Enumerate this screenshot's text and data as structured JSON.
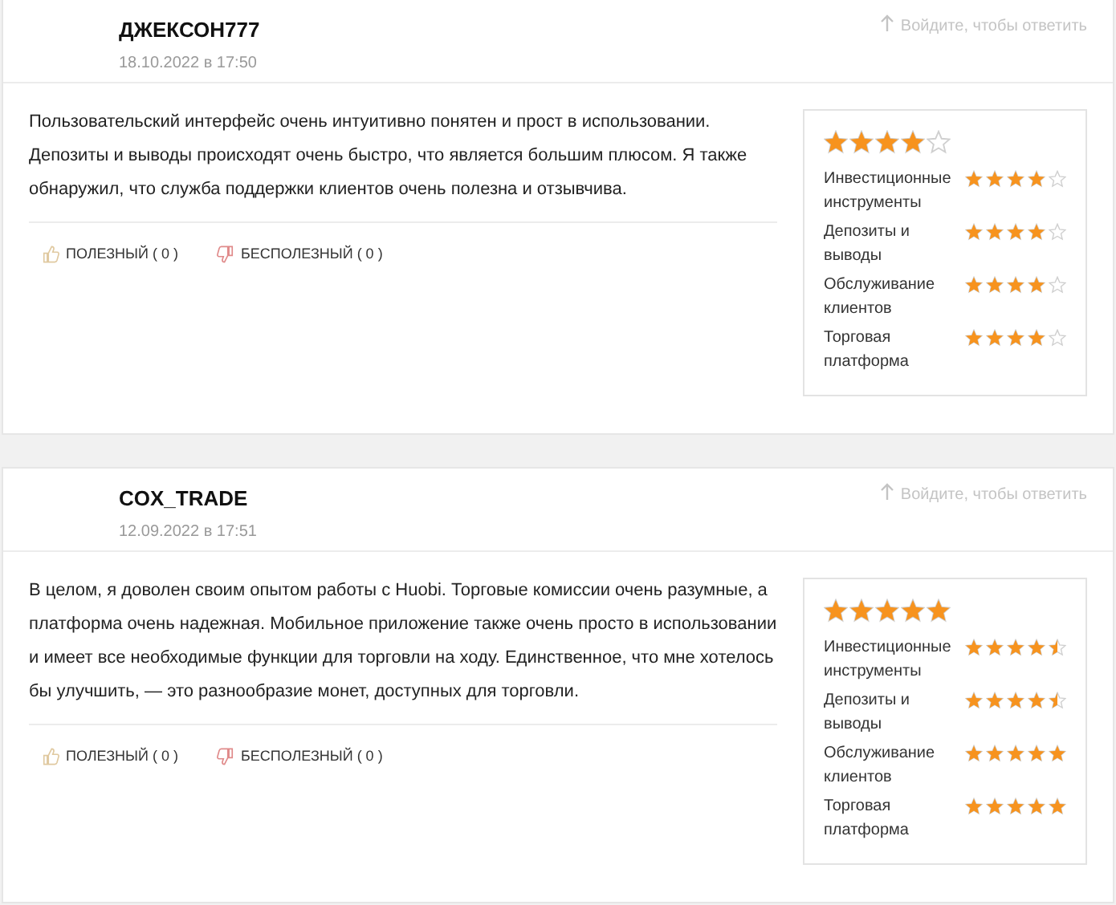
{
  "reviews": [
    {
      "author": "ДЖЕКСОН777",
      "date": "18.10.2022 в 17:50",
      "reply_link": "Войдите, чтобы ответить",
      "text": "Пользовательский интерфейс очень интуитивно понятен и прост в использовании. Депозиты и выводы происходят очень быстро, что является большим плюсом. Я также обнаружил, что служба поддержки клиентов очень полезна и отзывчива.",
      "helpful": "ПОЛЕЗНЫЙ",
      "helpful_count": "( 0 )",
      "unhelpful": "БЕСПОЛЕЗНЫЙ",
      "unhelpful_count": "( 0 )",
      "overall": {
        "stars": 4
      },
      "ratings": [
        {
          "label": "Инвестиционные инструменты",
          "stars": 4
        },
        {
          "label": "Депозиты и выводы",
          "stars": 4
        },
        {
          "label": "Обслуживание клиентов",
          "stars": 4
        },
        {
          "label": "Торговая платформа",
          "stars": 4
        }
      ]
    },
    {
      "author": "COX_TRADE",
      "date": "12.09.2022 в 17:51",
      "reply_link": "Войдите, чтобы ответить",
      "text": "В целом, я доволен своим опытом работы с Huobi. Торговые комиссии очень разумные, а платформа очень надежная. Мобильное приложение также очень просто в использовании и имеет все необходимые функции для торговли на ходу. Единственное, что мне хотелось бы улучшить, — это разнообразие монет, доступных для торговли.",
      "helpful": "ПОЛЕЗНЫЙ",
      "helpful_count": "( 0 )",
      "unhelpful": "БЕСПОЛЕЗНЫЙ",
      "unhelpful_count": "( 0 )",
      "overall": {
        "stars": 5
      },
      "ratings": [
        {
          "label": "Инвестиционные инструменты",
          "stars": 4.5
        },
        {
          "label": "Депозиты и выводы",
          "stars": 4.5
        },
        {
          "label": "Обслуживание клиентов",
          "stars": 5
        },
        {
          "label": "Торговая платформа",
          "stars": 5
        }
      ]
    }
  ]
}
